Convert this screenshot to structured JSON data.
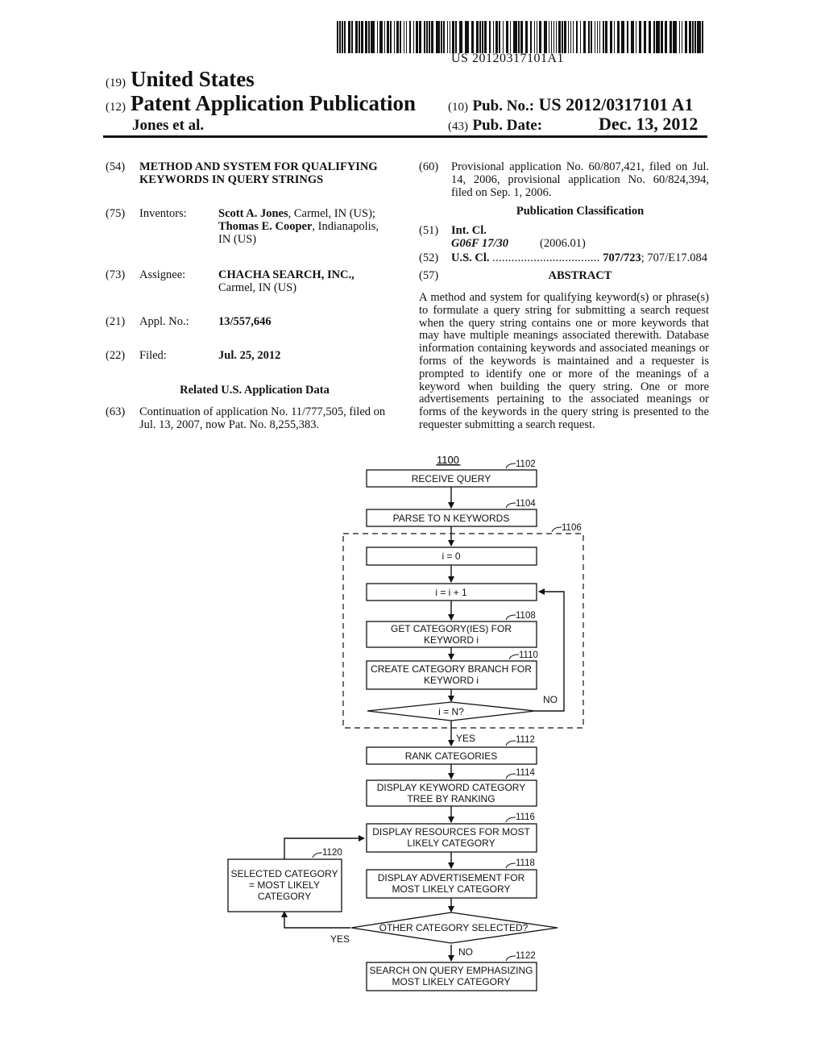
{
  "barcode": {
    "number": "US 20120317101A1"
  },
  "header": {
    "country_code": "(19)",
    "country": "United States",
    "type_code": "(12)",
    "type": "Patent Application Publication",
    "authors": "Jones et al.",
    "pub_no_code": "(10)",
    "pub_no_label": "Pub. No.:",
    "pub_no": "US 2012/0317101 A1",
    "pub_date_code": "(43)",
    "pub_date_label": "Pub. Date:",
    "pub_date": "Dec. 13, 2012"
  },
  "left": {
    "title": {
      "code": "(54)",
      "text": "METHOD AND SYSTEM FOR QUALIFYING KEYWORDS IN QUERY STRINGS"
    },
    "inventors": {
      "code": "(75)",
      "label": "Inventors:",
      "name1": "Scott A. Jones",
      "loc1": ", Carmel, IN (US);",
      "name2": "Thomas E. Cooper",
      "loc2": ", Indianapolis,",
      "loc2b": "IN (US)"
    },
    "assignee": {
      "code": "(73)",
      "label": "Assignee:",
      "name": "CHACHA SEARCH, INC.,",
      "loc": "Carmel, IN (US)"
    },
    "appl": {
      "code": "(21)",
      "label": "Appl. No.:",
      "value": "13/557,646"
    },
    "filed": {
      "code": "(22)",
      "label": "Filed:",
      "value": "Jul. 25, 2012"
    },
    "related_heading": "Related U.S. Application Data",
    "continuation": {
      "code": "(63)",
      "line1": "Continuation of application No. 11/777,505, filed on",
      "line2": "Jul. 13, 2007, now Pat. No. 8,255,383."
    }
  },
  "right": {
    "provisional": {
      "code": "(60)",
      "line1": "Provisional application No. 60/807,421, filed on Jul.",
      "line2": "14, 2006, provisional application No. 60/824,394,",
      "line3": "filed on Sep. 1, 2006."
    },
    "pub_class_heading": "Publication Classification",
    "int_cl": {
      "code": "(51)",
      "label": "Int. Cl.",
      "class": "G06F 17/30",
      "year": "(2006.01)"
    },
    "us_cl": {
      "code": "(52)",
      "label": "U.S. Cl.",
      "dots": "..................................",
      "value_bold": "707/723",
      "value_rest": "; 707/E17.084"
    },
    "abstract": {
      "code": "(57)",
      "heading": "ABSTRACT",
      "text": "A method and system for qualifying keyword(s) or phrase(s) to formulate a query string for submitting a search request when the query string contains one or more keywords that may have multiple meanings associated therewith. Database information containing keywords and associated meanings or forms of the keywords is maintained and a requester is prompted to identify one or more of the meanings of a keyword when building the query string. One or more advertisements pertaining to the associated meanings or forms of the keywords in the query string is presented to the requester submitting a search request."
    }
  },
  "figure": {
    "id": "1100",
    "nodes": {
      "n1102": {
        "ref": "1102",
        "lines": [
          "RECEIVE QUERY"
        ]
      },
      "n1104": {
        "ref": "1104",
        "lines": [
          "PARSE TO N KEYWORDS"
        ]
      },
      "n1106": {
        "ref": "1106"
      },
      "i0": {
        "lines": [
          "i = 0"
        ]
      },
      "inc": {
        "lines": [
          "i = i + 1"
        ]
      },
      "n1108": {
        "ref": "1108",
        "lines": [
          "GET CATEGORY(IES) FOR",
          "KEYWORD i"
        ]
      },
      "n1110": {
        "ref": "1110",
        "lines": [
          "CREATE CATEGORY BRANCH FOR",
          "KEYWORD i"
        ]
      },
      "dec1": {
        "lines": [
          "i = N?"
        ],
        "no": "NO",
        "yes": "YES"
      },
      "n1112": {
        "ref": "1112",
        "lines": [
          "RANK CATEGORIES"
        ]
      },
      "n1114": {
        "ref": "1114",
        "lines": [
          "DISPLAY KEYWORD CATEGORY",
          "TREE BY RANKING"
        ]
      },
      "n1116": {
        "ref": "1116",
        "lines": [
          "DISPLAY RESOURCES FOR MOST",
          "LIKELY CATEGORY"
        ]
      },
      "n1118": {
        "ref": "1118",
        "lines": [
          "DISPLAY ADVERTISEMENT FOR",
          "MOST LIKELY CATEGORY"
        ]
      },
      "n1120": {
        "ref": "1120",
        "lines": [
          "SELECTED CATEGORY",
          "= MOST LIKELY",
          "CATEGORY"
        ]
      },
      "dec2": {
        "lines": [
          "OTHER CATEGORY SELECTED?"
        ],
        "yes": "YES",
        "no": "NO"
      },
      "n1122": {
        "ref": "1122",
        "lines": [
          "SEARCH ON QUERY EMPHASIZING",
          "MOST LIKELY CATEGORY"
        ]
      }
    }
  }
}
